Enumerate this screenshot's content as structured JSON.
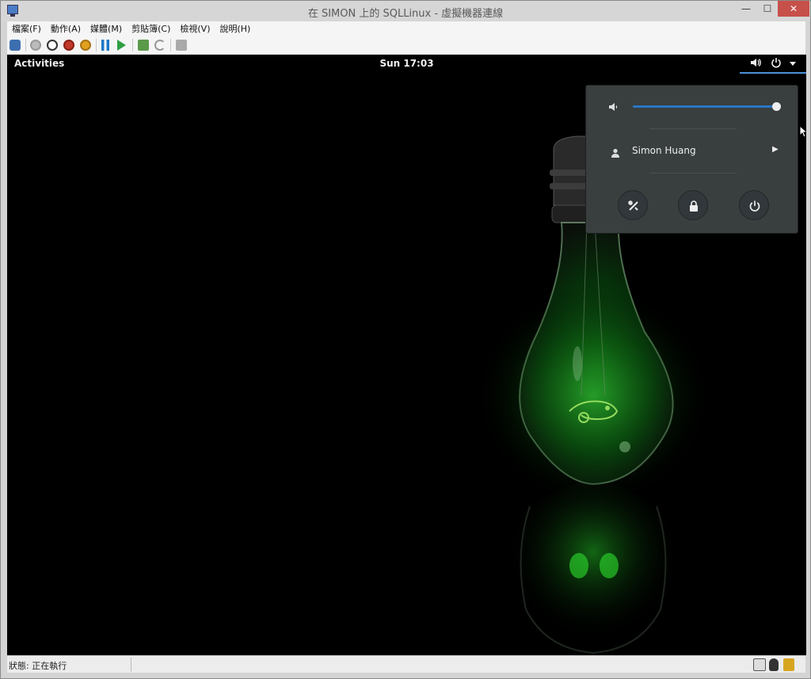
{
  "window": {
    "title": "在 SIMON 上的 SQLLinux - 虛擬機器連線",
    "minimize": "—",
    "maximize": "☐",
    "close": "✕"
  },
  "menubar": {
    "items": [
      "檔案(F)",
      "動作(A)",
      "媒體(M)",
      "剪貼簿(C)",
      "檢視(V)",
      "說明(H)"
    ]
  },
  "toolbar": {
    "buttons": [
      "ctrl-alt-del-icon",
      "start-icon",
      "turn-off-icon",
      "shutdown-icon",
      "save-icon",
      "pause-icon",
      "resume-icon",
      "checkpoint-icon",
      "revert-icon",
      "enhanced-session-icon"
    ],
    "colors": {
      "turn_off": "#c0392b",
      "save": "#e0a020",
      "pause": "#1f77c8",
      "resume": "#2ea043"
    }
  },
  "gnome": {
    "activities": "Activities",
    "clock": "Sun 17:03",
    "system_menu": {
      "volume_level": 1.0,
      "user_name": "Simon Huang"
    },
    "accent": "#4a90d9"
  },
  "statusbar": {
    "status": "狀態: 正在執行"
  }
}
